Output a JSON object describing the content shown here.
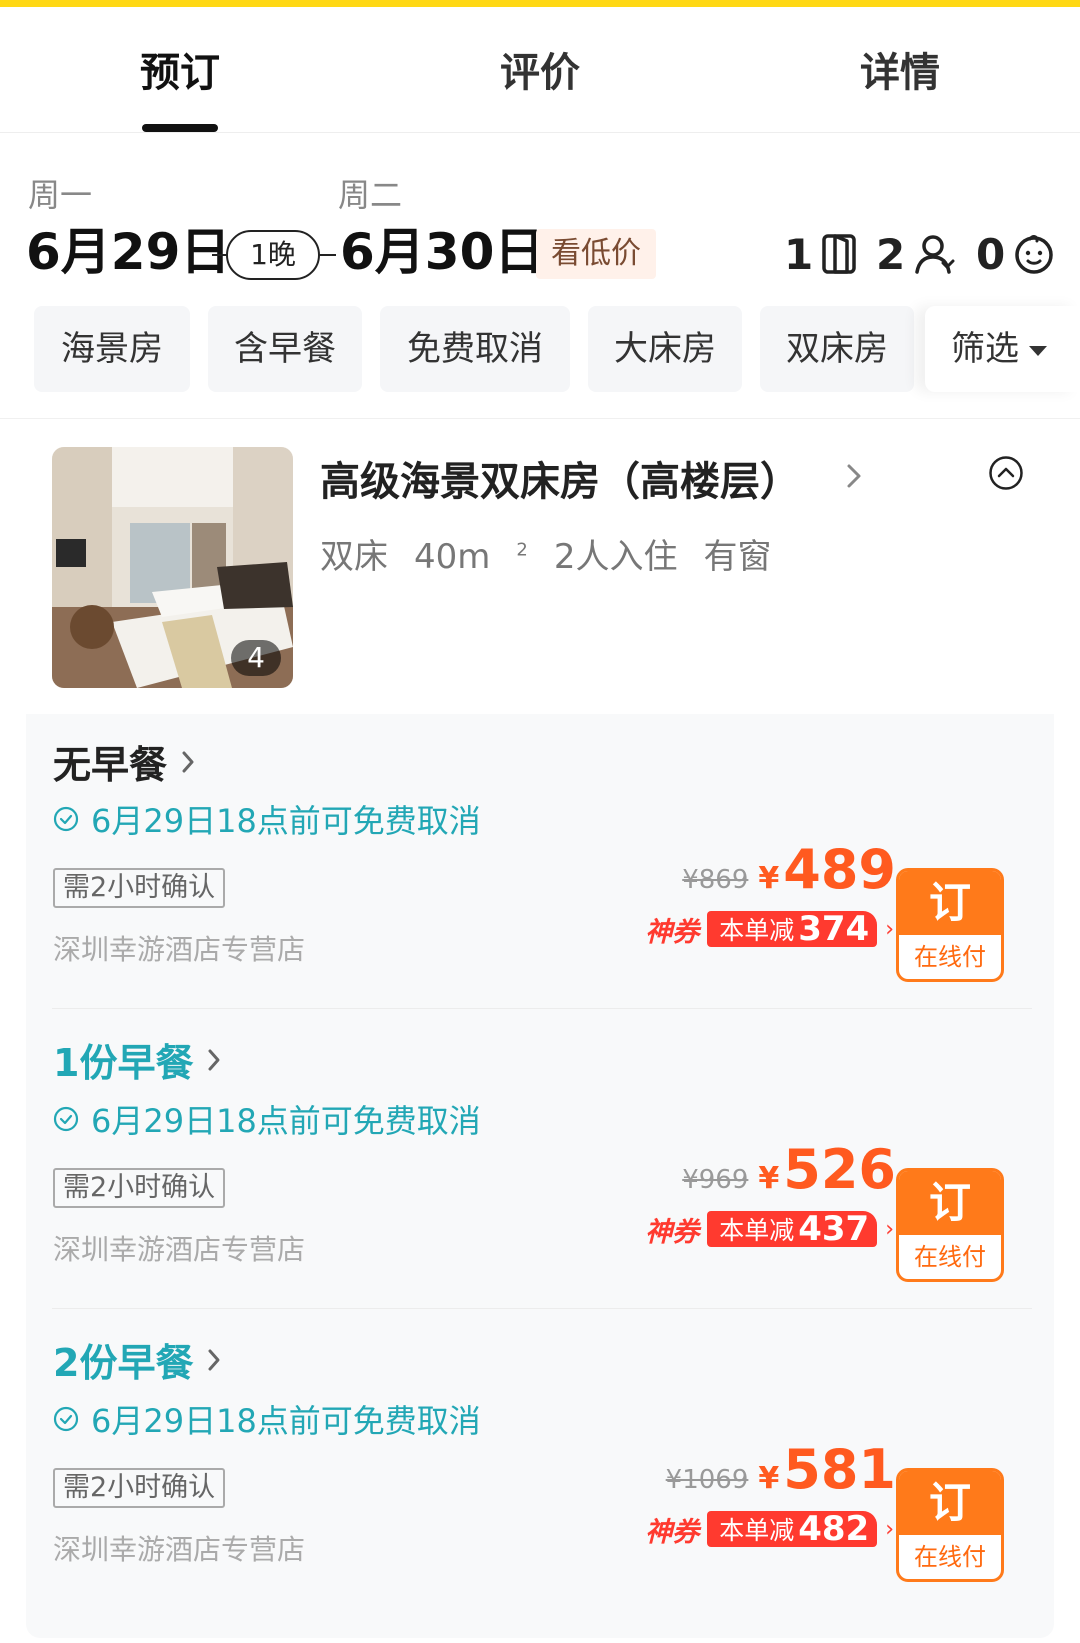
{
  "tabs": [
    {
      "label": "预订",
      "active": true
    },
    {
      "label": "评价",
      "active": false
    },
    {
      "label": "详情",
      "active": false
    }
  ],
  "stay": {
    "checkin_weekday": "周一",
    "checkin_date": "6月29日",
    "checkout_weekday": "周二",
    "checkout_date": "6月30日",
    "nights": "1晚",
    "low_price_label": "看低价",
    "rooms": "1",
    "adults": "2",
    "children": "0"
  },
  "filters": [
    "海景房",
    "含早餐",
    "免费取消",
    "大床房",
    "双床房"
  ],
  "filter_button": "筛选",
  "room": {
    "name": "高级海景双床房（高楼层）",
    "attrs": [
      "双床",
      "40m",
      "2人入住",
      "有窗"
    ],
    "area_sup": "2",
    "image_count": "4"
  },
  "rates": [
    {
      "meal": "无早餐",
      "meal_style": "plain",
      "cancel": "6月29日18点前可免费取消",
      "confirm": "需2小时确认",
      "shop": "深圳幸游酒店专营店",
      "orig_price": "¥869",
      "currency": "¥",
      "price": "489",
      "coupon_tag": "神券",
      "coupon_label": "本单减",
      "coupon_value": "374",
      "book": "订",
      "pay": "在线付"
    },
    {
      "meal": "1份早餐",
      "meal_style": "teal",
      "cancel": "6月29日18点前可免费取消",
      "confirm": "需2小时确认",
      "shop": "深圳幸游酒店专营店",
      "orig_price": "¥969",
      "currency": "¥",
      "price": "526",
      "coupon_tag": "神券",
      "coupon_label": "本单减",
      "coupon_value": "437",
      "book": "订",
      "pay": "在线付"
    },
    {
      "meal": "2份早餐",
      "meal_style": "teal",
      "cancel": "6月29日18点前可免费取消",
      "confirm": "需2小时确认",
      "shop": "深圳幸游酒店专营店",
      "orig_price": "¥1069",
      "currency": "¥",
      "price": "581",
      "coupon_tag": "神券",
      "coupon_label": "本单减",
      "coupon_value": "482",
      "book": "订",
      "pay": "在线付"
    }
  ],
  "colors": {
    "accent_yellow": "#ffd814",
    "teal": "#22a7b5",
    "price_orange": "#ff5a1f",
    "coupon_red": "#ff3a2f",
    "book_orange": "#ff7a1a"
  },
  "icons": [
    "room-door-icon",
    "person-icon",
    "child-face-icon",
    "chevron-right-icon",
    "collapse-up-icon",
    "check-circle-icon"
  ]
}
